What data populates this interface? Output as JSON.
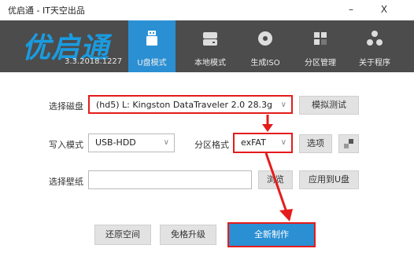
{
  "window": {
    "title": "优启通 - IT天空出品",
    "minimize": "–",
    "close": "X"
  },
  "app": {
    "logo": "优启通",
    "version": "3.3.2018.1227"
  },
  "tabs": [
    {
      "label": "U盘模式",
      "icon": "usb-drive-icon"
    },
    {
      "label": "本地模式",
      "icon": "hard-disk-icon"
    },
    {
      "label": "生成ISO",
      "icon": "disc-icon"
    },
    {
      "label": "分区管理",
      "icon": "partition-grid-icon"
    },
    {
      "label": "关于程序",
      "icon": "about-dots-icon"
    }
  ],
  "form": {
    "disk_label": "选择磁盘",
    "disk_value": "(hd5) L: Kingston DataTraveler 2.0 28.3g",
    "simulate_button": "模拟测试",
    "write_label": "写入模式",
    "write_value": "USB-HDD",
    "partition_label": "分区格式",
    "partition_value": "exFAT",
    "options_button": "选项",
    "wallpaper_label": "选择壁纸",
    "wallpaper_value": "",
    "browse_button": "浏览",
    "apply_button": "应用到U盘"
  },
  "actions": {
    "restore": "还原空间",
    "upgrade": "免格升级",
    "create": "全新制作"
  },
  "colors": {
    "accent": "#2a8fd3",
    "toolbar": "#4c4c4c",
    "highlight": "#e51b1b",
    "logo": "#1a9be0"
  }
}
